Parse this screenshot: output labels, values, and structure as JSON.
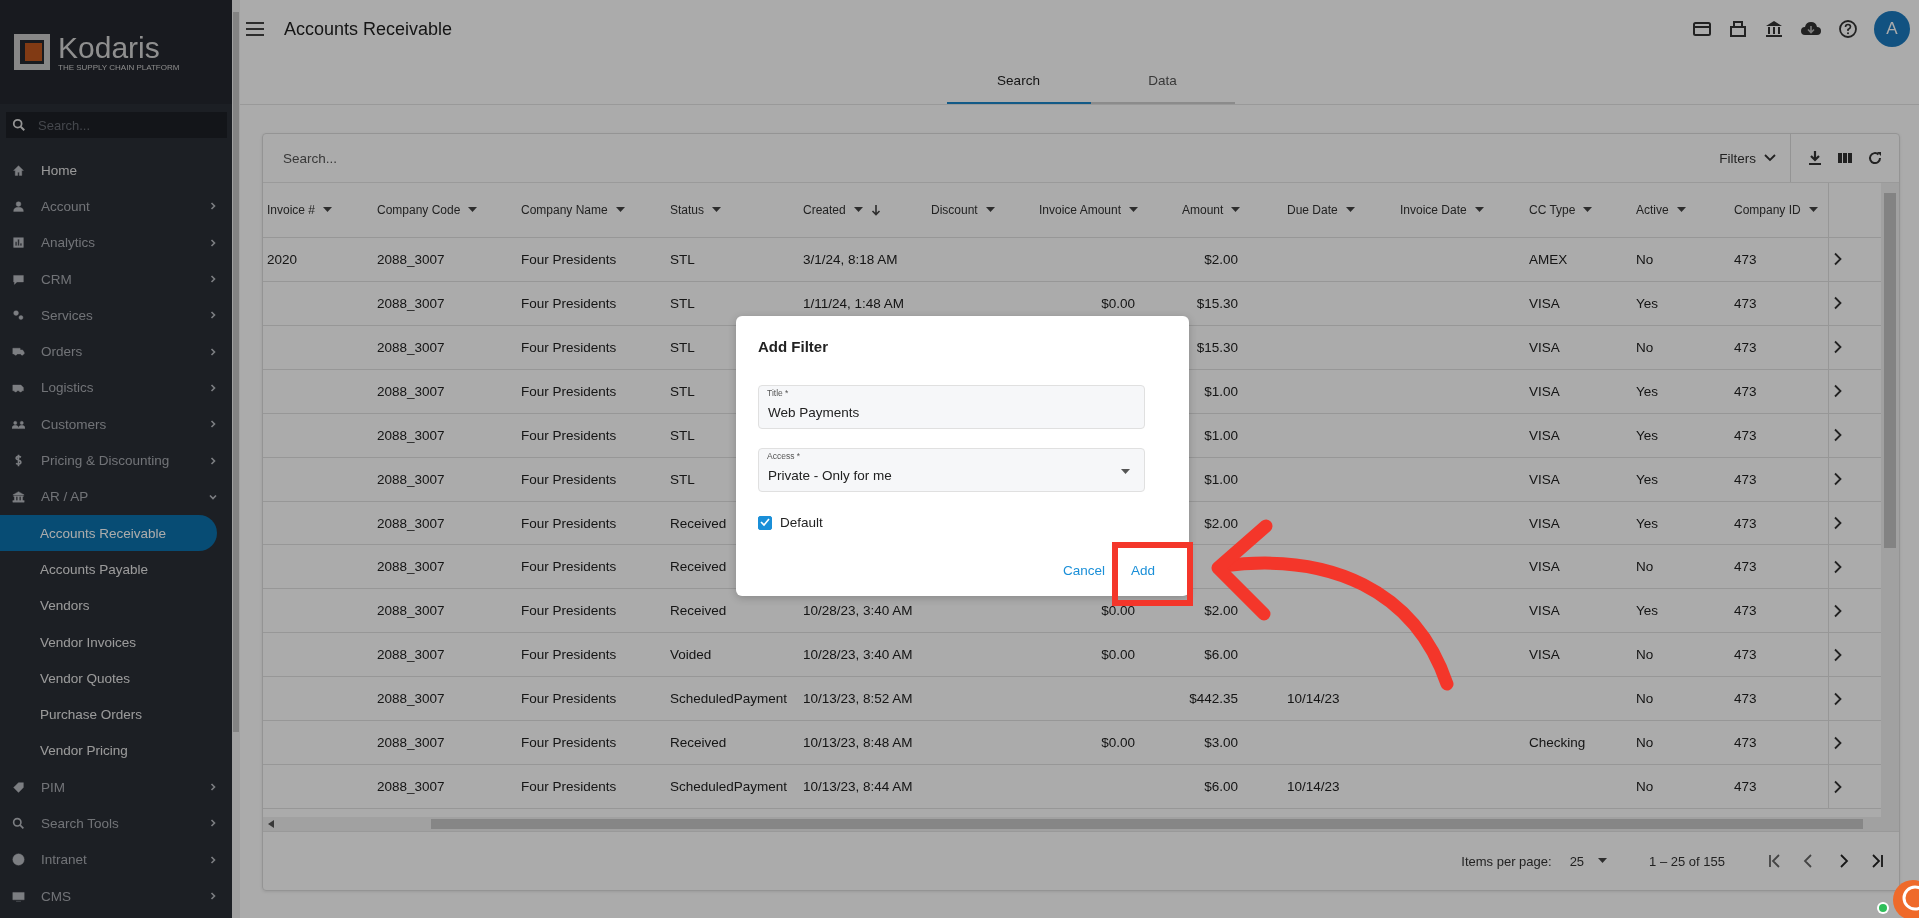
{
  "sidebar": {
    "logo": {
      "name": "Kodaris",
      "tagline": "THE SUPPLY CHAIN PLATFORM"
    },
    "search": {
      "placeholder": "Search..."
    },
    "items": [
      {
        "label": "Home",
        "kind": "link"
      },
      {
        "label": "Account",
        "kind": "group",
        "expanded": false
      },
      {
        "label": "Analytics",
        "kind": "group",
        "expanded": false
      },
      {
        "label": "CRM",
        "kind": "group",
        "expanded": false
      },
      {
        "label": "Services",
        "kind": "group",
        "expanded": false
      },
      {
        "label": "Orders",
        "kind": "group",
        "expanded": false
      },
      {
        "label": "Logistics",
        "kind": "group",
        "expanded": false
      },
      {
        "label": "Customers",
        "kind": "group",
        "expanded": false
      },
      {
        "label": "Pricing & Discounting",
        "kind": "group",
        "expanded": false
      },
      {
        "label": "AR / AP",
        "kind": "group",
        "expanded": true,
        "children": [
          {
            "label": "Accounts Receivable",
            "selected": true
          },
          {
            "label": "Accounts Payable",
            "selected": false
          },
          {
            "label": "Vendors",
            "selected": false
          },
          {
            "label": "Vendor Invoices",
            "selected": false
          },
          {
            "label": "Vendor Quotes",
            "selected": false
          },
          {
            "label": "Purchase Orders",
            "selected": false
          },
          {
            "label": "Vendor Pricing",
            "selected": false
          }
        ]
      },
      {
        "label": "PIM",
        "kind": "group",
        "expanded": false
      },
      {
        "label": "Search Tools",
        "kind": "group",
        "expanded": false
      },
      {
        "label": "Intranet",
        "kind": "group",
        "expanded": false
      },
      {
        "label": "CMS",
        "kind": "group",
        "expanded": false
      }
    ]
  },
  "header": {
    "title": "Accounts Receivable",
    "avatar": "A"
  },
  "tabs": [
    {
      "label": "Search",
      "selected": true
    },
    {
      "label": "Data",
      "selected": false
    }
  ],
  "toolbar": {
    "search": {
      "placeholder": "Search..."
    },
    "filters": "Filters"
  },
  "table": {
    "columns": [
      {
        "label": "Invoice #",
        "sorted": false
      },
      {
        "label": "Company Code",
        "sorted": false
      },
      {
        "label": "Company Name",
        "sorted": false
      },
      {
        "label": "Status",
        "sorted": false
      },
      {
        "label": "Created",
        "sorted": true
      },
      {
        "label": "Discount",
        "sorted": false
      },
      {
        "label": "Invoice Amount",
        "sorted": false
      },
      {
        "label": "Amount",
        "sorted": false
      },
      {
        "label": "Due Date",
        "sorted": false
      },
      {
        "label": "Invoice Date",
        "sorted": false
      },
      {
        "label": "CC Type",
        "sorted": false
      },
      {
        "label": "Active",
        "sorted": false
      },
      {
        "label": "Company ID",
        "sorted": false
      }
    ],
    "rows": [
      {
        "invoice": "2020",
        "code": "2088_3007",
        "name": "Four Presidents",
        "status": "STL",
        "created": "3/1/24, 8:18 AM",
        "amount": "$2.00",
        "cc": "AMEX",
        "active": "No",
        "company_id": "473"
      },
      {
        "code": "2088_3007",
        "name": "Four Presidents",
        "status": "STL",
        "created": "1/11/24, 1:48 AM",
        "invoice_amount": "$0.00",
        "amount": "$15.30",
        "cc": "VISA",
        "active": "Yes",
        "company_id": "473"
      },
      {
        "code": "2088_3007",
        "name": "Four Presidents",
        "status": "STL",
        "amount": "$15.30",
        "cc": "VISA",
        "active": "No",
        "company_id": "473"
      },
      {
        "code": "2088_3007",
        "name": "Four Presidents",
        "status": "STL",
        "amount": "$1.00",
        "cc": "VISA",
        "active": "Yes",
        "company_id": "473"
      },
      {
        "code": "2088_3007",
        "name": "Four Presidents",
        "status": "STL",
        "amount": "$1.00",
        "cc": "VISA",
        "active": "Yes",
        "company_id": "473"
      },
      {
        "code": "2088_3007",
        "name": "Four Presidents",
        "status": "STL",
        "amount": "$1.00",
        "cc": "VISA",
        "active": "Yes",
        "company_id": "473"
      },
      {
        "code": "2088_3007",
        "name": "Four Presidents",
        "status": "Received",
        "amount": "$2.00",
        "cc": "VISA",
        "active": "Yes",
        "company_id": "473"
      },
      {
        "code": "2088_3007",
        "name": "Four Presidents",
        "status": "Received",
        "cc": "VISA",
        "active": "No",
        "company_id": "473"
      },
      {
        "code": "2088_3007",
        "name": "Four Presidents",
        "status": "Received",
        "created": "10/28/23, 3:40 AM",
        "invoice_amount": "$0.00",
        "amount": "$2.00",
        "cc": "VISA",
        "active": "Yes",
        "company_id": "473"
      },
      {
        "code": "2088_3007",
        "name": "Four Presidents",
        "status": "Voided",
        "created": "10/28/23, 3:40 AM",
        "invoice_amount": "$0.00",
        "amount": "$6.00",
        "cc": "VISA",
        "active": "No",
        "company_id": "473"
      },
      {
        "code": "2088_3007",
        "name": "Four Presidents",
        "status": "ScheduledPayment",
        "created": "10/13/23, 8:52 AM",
        "amount": "$442.35",
        "due": "10/14/23",
        "active": "No",
        "company_id": "473"
      },
      {
        "code": "2088_3007",
        "name": "Four Presidents",
        "status": "Received",
        "created": "10/13/23, 8:48 AM",
        "invoice_amount": "$0.00",
        "amount": "$3.00",
        "cc": "Checking",
        "active": "No",
        "company_id": "473"
      },
      {
        "code": "2088_3007",
        "name": "Four Presidents",
        "status": "ScheduledPayment",
        "created": "10/13/23, 8:44 AM",
        "amount": "$6.00",
        "due": "10/14/23",
        "active": "No",
        "company_id": "473"
      }
    ]
  },
  "paginator": {
    "items_per_page": "Items per page:",
    "page_size": "25",
    "range": "1 – 25 of 155"
  },
  "dialog": {
    "title": "Add Filter",
    "fields": [
      {
        "kind": "text",
        "label": "Title *",
        "value": "Web Payments"
      },
      {
        "kind": "select",
        "label": "Access *",
        "value": "Private - Only for me"
      }
    ],
    "checkbox": {
      "label": "Default",
      "checked": true
    },
    "buttons": [
      "Cancel",
      "Add"
    ]
  }
}
